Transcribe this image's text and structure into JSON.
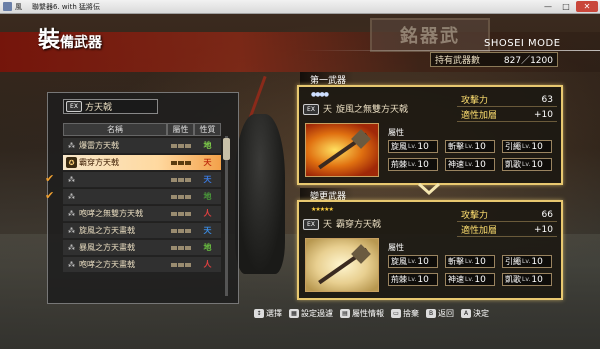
{
  "window": {
    "title": "風",
    "subtitle": "聯繫器6. with 猛將伝",
    "minimize": "—",
    "maximize": "□",
    "close": "✕"
  },
  "header": {
    "title_big": "裝",
    "title_rest": "備武器",
    "mode": "SHOSEI MODE",
    "stock_label": "持有武器數",
    "stock_count": "827／1200",
    "sign_text": "銘器武"
  },
  "list": {
    "selected_weapon_name": "方天戟",
    "columns": {
      "name": "名稱",
      "attr": "屬性",
      "nature": "性質"
    },
    "rows": [
      {
        "name": "爆雷方天戟",
        "nature": "地",
        "nature_color": "#7fd04a",
        "checked": false,
        "selected": false,
        "dim": false
      },
      {
        "name": "霸穿方天戟",
        "nature": "天",
        "nature_color": "#c03010",
        "checked": false,
        "selected": true,
        "dim": false
      },
      {
        "name": "",
        "nature": "天",
        "nature_color": "#3a7ae0",
        "checked": true,
        "selected": false,
        "dim": true
      },
      {
        "name": "",
        "nature": "地",
        "nature_color": "#4a9a3a",
        "checked": true,
        "selected": false,
        "dim": true
      },
      {
        "name": "咆哮之無雙方天戟",
        "nature": "人",
        "nature_color": "#e04040",
        "checked": false,
        "selected": false,
        "dim": false
      },
      {
        "name": "旋風之方天畫戟",
        "nature": "天",
        "nature_color": "#3a8ae0",
        "checked": false,
        "selected": false,
        "dim": false
      },
      {
        "name": "暴風之方天畫戟",
        "nature": "地",
        "nature_color": "#6ac040",
        "checked": false,
        "selected": false,
        "dim": false
      },
      {
        "name": "咆哮之方天畫戟",
        "nature": "人",
        "nature_color": "#e04040",
        "checked": false,
        "selected": false,
        "dim": false
      }
    ]
  },
  "first_weapon": {
    "tab": "第一武器",
    "ex": "EX",
    "nature": "天",
    "name": "旋風之無雙方天戟",
    "attack_label": "攻擊力",
    "attack_value": "63",
    "bonus_label": "適性加層",
    "bonus_value": "+10",
    "attr_label": "屬性",
    "chips": [
      {
        "name": "旋風",
        "lv": "Lv.",
        "num": "10"
      },
      {
        "name": "斬擊",
        "lv": "Lv.",
        "num": "10"
      },
      {
        "name": "引繩",
        "lv": "Lv.",
        "num": "10"
      },
      {
        "name": "荊棘",
        "lv": "Lv.",
        "num": "10"
      },
      {
        "name": "神速",
        "lv": "Lv.",
        "num": "10"
      },
      {
        "name": "凱歌",
        "lv": "Lv.",
        "num": "10"
      }
    ]
  },
  "change_weapon": {
    "tab": "變更武器",
    "ex": "EX",
    "nature": "天",
    "name": "霸穿方天戟",
    "attack_label": "攻擊力",
    "attack_value": "66",
    "bonus_label": "適性加層",
    "bonus_value": "+10",
    "attr_label": "屬性",
    "chips": [
      {
        "name": "旋風",
        "lv": "Lv.",
        "num": "10"
      },
      {
        "name": "斬擊",
        "lv": "Lv.",
        "num": "10"
      },
      {
        "name": "引繩",
        "lv": "Lv.",
        "num": "10"
      },
      {
        "name": "荊棘",
        "lv": "Lv.",
        "num": "10"
      },
      {
        "name": "神速",
        "lv": "Lv.",
        "num": "10"
      },
      {
        "name": "凱歌",
        "lv": "Lv.",
        "num": "10"
      }
    ]
  },
  "controls": [
    {
      "key": "↕",
      "label": "選擇"
    },
    {
      "key": "▦",
      "label": "設定過濾"
    },
    {
      "key": "▤",
      "label": "屬性情報"
    },
    {
      "key": "▭",
      "label": "捨棄"
    },
    {
      "key": "B",
      "label": "返回"
    },
    {
      "key": "A",
      "label": "決定"
    }
  ],
  "colors": {
    "accent_gold": "#e8c870",
    "label_yellow": "#ffe070",
    "selected_row": "#ffd9a0"
  }
}
